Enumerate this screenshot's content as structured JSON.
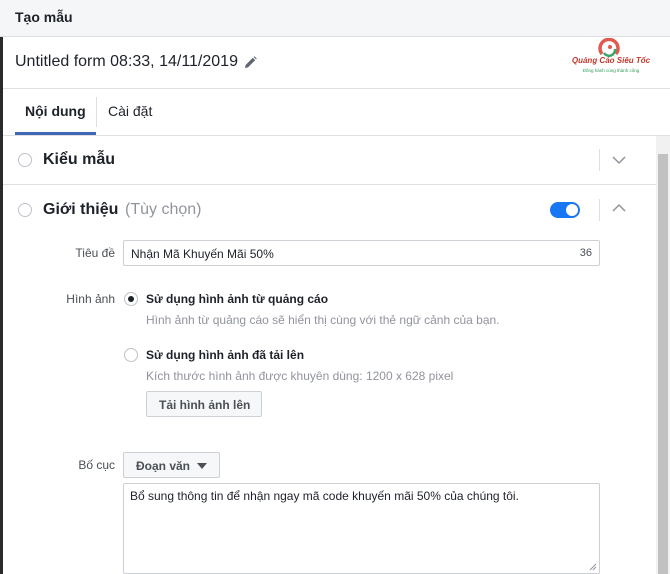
{
  "header": {
    "title": "Tạo mẫu"
  },
  "form": {
    "title": "Untitled form 08:33, 14/11/2019"
  },
  "logo": {
    "brand": "Quảng Cáo Siêu Tốc",
    "slogan": "Đồng hành cùng thành công"
  },
  "tabs": [
    {
      "label": "Nội dung",
      "active": true
    },
    {
      "label": "Cài đặt",
      "active": false
    }
  ],
  "sections": {
    "template": {
      "title": "Kiểu mẫu"
    },
    "intro": {
      "title": "Giới thiệu",
      "optional": "(Tùy chọn)",
      "enabled": true,
      "headline_label": "Tiêu đề",
      "headline_value": "Nhận Mã Khuyến Mãi 50%",
      "headline_count": "36",
      "image_label": "Hình ảnh",
      "image_option_ad": {
        "title": "Sử dụng hình ảnh từ quảng cáo",
        "desc": "Hình ảnh từ quảng cáo sẽ hiển thị cùng với thẻ ngữ cảnh của bạn.",
        "selected": true
      },
      "image_option_upload": {
        "title": "Sử dụng hình ảnh đã tải lên",
        "desc": "Kích thước hình ảnh được khuyên dùng: 1200 x 628 pixel",
        "selected": false
      },
      "upload_button": "Tải hình ảnh lên",
      "layout_label": "Bố cục",
      "layout_select": "Đoạn văn",
      "layout_text": "Bổ sung thông tin để nhận ngay mã code khuyến mãi 50% của chúng tôi."
    }
  },
  "colors": {
    "accent": "#4267b2",
    "toggle": "#1877f2"
  }
}
